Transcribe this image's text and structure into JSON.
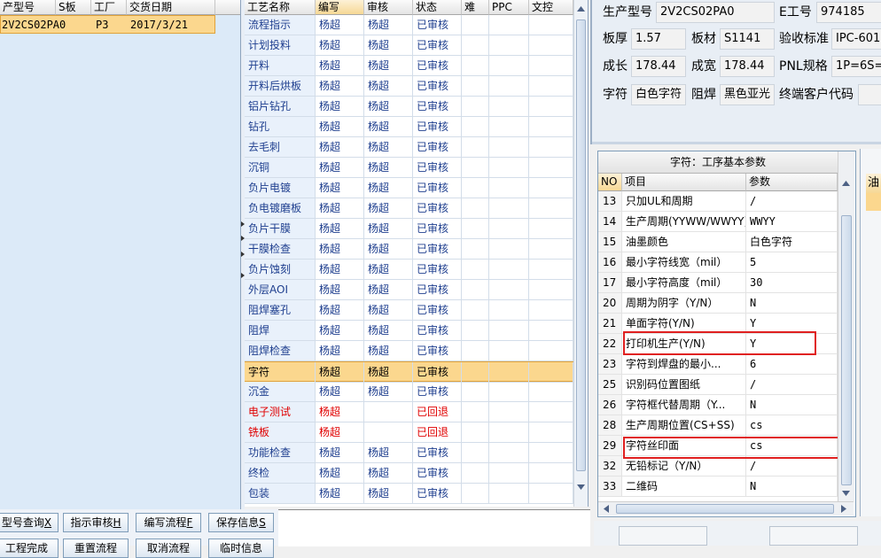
{
  "left_grid": {
    "headers": [
      "产型号",
      "S板",
      "工厂",
      "交货日期"
    ],
    "row": [
      "2V2CS02PA0",
      "P3",
      "2017/3/21"
    ]
  },
  "proc_grid": {
    "headers": [
      "工艺名称",
      "编写",
      "审核",
      "状态",
      "难",
      "PPC",
      "文控"
    ],
    "rows": [
      {
        "name": "流程指示",
        "writer": "杨超",
        "reviewer": "杨超",
        "status": "已审核"
      },
      {
        "name": "计划投料",
        "writer": "杨超",
        "reviewer": "杨超",
        "status": "已审核"
      },
      {
        "name": "开料",
        "writer": "杨超",
        "reviewer": "杨超",
        "status": "已审核"
      },
      {
        "name": "开料后烘板",
        "writer": "杨超",
        "reviewer": "杨超",
        "status": "已审核"
      },
      {
        "name": "铝片钻孔",
        "writer": "杨超",
        "reviewer": "杨超",
        "status": "已审核"
      },
      {
        "name": "钻孔",
        "writer": "杨超",
        "reviewer": "杨超",
        "status": "已审核"
      },
      {
        "name": "去毛刺",
        "writer": "杨超",
        "reviewer": "杨超",
        "status": "已审核"
      },
      {
        "name": "沉铜",
        "writer": "杨超",
        "reviewer": "杨超",
        "status": "已审核"
      },
      {
        "name": "负片电镀",
        "writer": "杨超",
        "reviewer": "杨超",
        "status": "已审核"
      },
      {
        "name": "负电镀磨板",
        "writer": "杨超",
        "reviewer": "杨超",
        "status": "已审核"
      },
      {
        "name": "负片干膜",
        "writer": "杨超",
        "reviewer": "杨超",
        "status": "已审核"
      },
      {
        "name": "干膜检查",
        "writer": "杨超",
        "reviewer": "杨超",
        "status": "已审核"
      },
      {
        "name": "负片蚀刻",
        "writer": "杨超",
        "reviewer": "杨超",
        "status": "已审核"
      },
      {
        "name": "外层AOI",
        "writer": "杨超",
        "reviewer": "杨超",
        "status": "已审核"
      },
      {
        "name": "阻焊塞孔",
        "writer": "杨超",
        "reviewer": "杨超",
        "status": "已审核"
      },
      {
        "name": "阻焊",
        "writer": "杨超",
        "reviewer": "杨超",
        "status": "已审核"
      },
      {
        "name": "阻焊检查",
        "writer": "杨超",
        "reviewer": "杨超",
        "status": "已审核"
      },
      {
        "name": "字符",
        "writer": "杨超",
        "reviewer": "杨超",
        "status": "已审核",
        "selected": true
      },
      {
        "name": "沉金",
        "writer": "杨超",
        "reviewer": "杨超",
        "status": "已审核"
      },
      {
        "name": "电子测试",
        "writer": "杨超",
        "reviewer": "",
        "status": "已回退",
        "returned": true
      },
      {
        "name": "铣板",
        "writer": "杨超",
        "reviewer": "",
        "status": "已回退",
        "returned": true
      },
      {
        "name": "功能检查",
        "writer": "杨超",
        "reviewer": "杨超",
        "status": "已审核"
      },
      {
        "name": "终检",
        "writer": "杨超",
        "reviewer": "杨超",
        "status": "已审核"
      },
      {
        "name": "包装",
        "writer": "杨超",
        "reviewer": "杨超",
        "status": "已审核"
      }
    ]
  },
  "buttons": {
    "row1": [
      {
        "label": "型号查询",
        "key": "X"
      },
      {
        "label": "指示审核",
        "key": "H"
      },
      {
        "label": "编写流程",
        "key": "F"
      },
      {
        "label": "保存信息",
        "key": "S"
      }
    ],
    "row2": [
      "工程完成",
      "重置流程",
      "取消流程",
      "临时信息"
    ]
  },
  "info": {
    "model_label": "生产型号",
    "model_value": "2V2CS02PA0",
    "e_no_label": "E工号",
    "e_no_value": "974185",
    "thickness_label": "板厚",
    "thickness_value": "1.57",
    "material_label": "板材",
    "material_value": "S1141",
    "standard_label": "验收标准",
    "standard_value": "IPC-601",
    "length_label": "成长",
    "length_value": "178.44",
    "width_label": "成宽",
    "width_value": "178.44",
    "pnl_label": "PNL规格",
    "pnl_value": "1P=6S=",
    "char_label": "字符",
    "char_value": "白色字符",
    "mask_label": "阻焊",
    "mask_value": "黑色亚光",
    "customer_label": "终端客户代码",
    "customer_value": ""
  },
  "param_grid": {
    "caption": "字符：工序基本参数",
    "headers": [
      "NO",
      "项目",
      "参数"
    ],
    "rows": [
      {
        "no": "13",
        "item": "只加UL和周期",
        "value": "/"
      },
      {
        "no": "14",
        "item": "生产周期(YYWW/WWYY)",
        "value": "WWYY"
      },
      {
        "no": "15",
        "item": "油墨颜色",
        "value": "白色字符"
      },
      {
        "no": "16",
        "item": "最小字符线宽（mil）",
        "value": "5"
      },
      {
        "no": "17",
        "item": "最小字符高度（mil）",
        "value": "30"
      },
      {
        "no": "20",
        "item": "周期为阴字（Y/N）",
        "value": "N"
      },
      {
        "no": "21",
        "item": "单面字符(Y/N)",
        "value": "Y"
      },
      {
        "no": "22",
        "item": "打印机生产(Y/N)",
        "value": "Y"
      },
      {
        "no": "23",
        "item": "字符到焊盘的最小...",
        "value": "6"
      },
      {
        "no": "25",
        "item": "识别码位置图纸",
        "value": "/"
      },
      {
        "no": "26",
        "item": "字符框代替周期（Y...",
        "value": "N"
      },
      {
        "no": "28",
        "item": "生产周期位置(CS+SS)",
        "value": "cs"
      },
      {
        "no": "29",
        "item": "字符丝印面",
        "value": "cs"
      },
      {
        "no": "32",
        "item": "无铅标记（Y/N）",
        "value": "/"
      },
      {
        "no": "33",
        "item": "二维码",
        "value": "N"
      }
    ]
  },
  "edge_tab": "油",
  "colors": {
    "selected_row": "#fbd78e",
    "selected_border": "#e0a23a",
    "highlight_box": "#e02020",
    "returned_text": "#e00000"
  }
}
